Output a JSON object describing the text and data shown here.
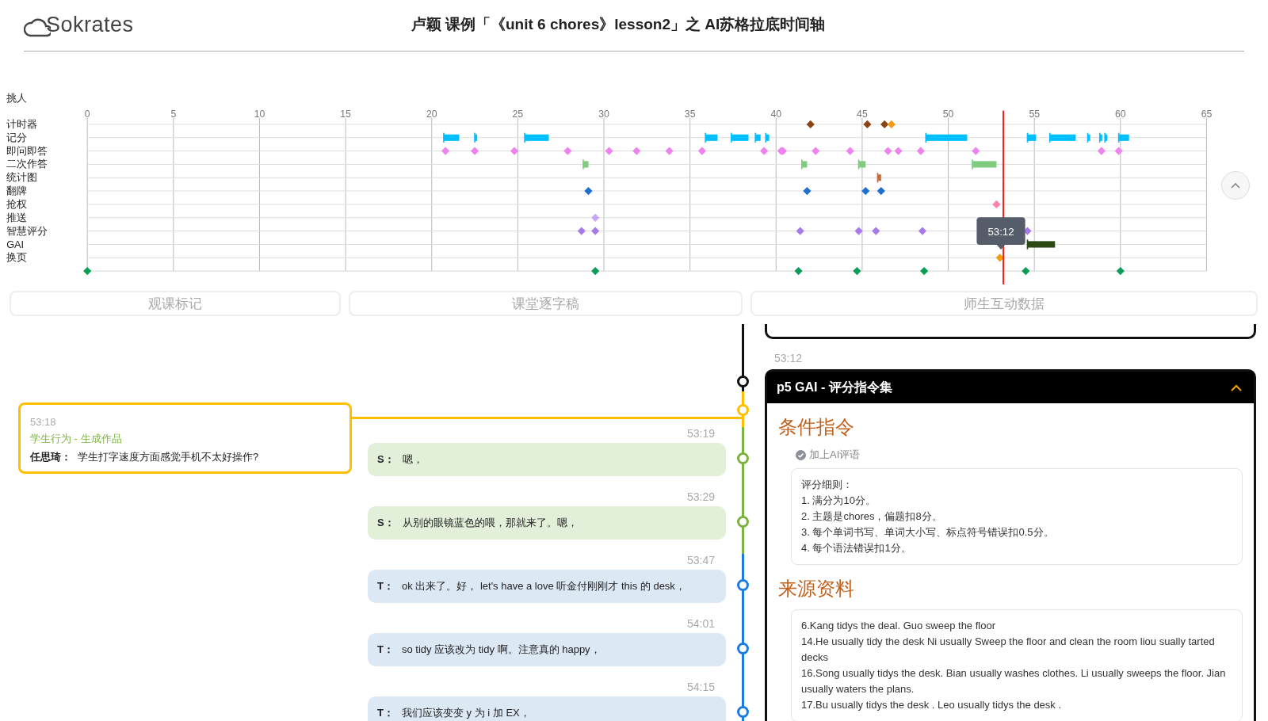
{
  "header": {
    "logo": "Sokrates",
    "title": "卢颖 课例「《unit 6 chores》lesson2」之 AI苏格拉底时间轴"
  },
  "timeline": {
    "axis_labels": [
      "0",
      "5",
      "10",
      "15",
      "20",
      "25",
      "30",
      "35",
      "40",
      "45",
      "50",
      "55",
      "60",
      "65"
    ],
    "row_labels": [
      "挑人",
      "计时器",
      "记分",
      "即问即答",
      "二次作答",
      "统计图",
      "翻牌",
      "抢权",
      "推送",
      "智慧评分",
      "GAI",
      "换页"
    ],
    "tooltip": "53:12"
  },
  "tabs": [
    {
      "label": "观课标记",
      "selected": false
    },
    {
      "label": "课堂逐字稿",
      "selected": false
    },
    {
      "label": "师生互动数据",
      "selected": false
    }
  ],
  "note": {
    "time": "53:18",
    "category": "学生行为 - 生成作品",
    "author": "任思琦：",
    "text": "学生打字速度方面感觉手机不太好操作?"
  },
  "transcript": [
    {
      "time": "53:19",
      "kind": "student",
      "speaker": "S：",
      "text": "嗯，"
    },
    {
      "time": "53:29",
      "kind": "student",
      "speaker": "S：",
      "text": "从别的眼镜蓝色的喂，那就来了。嗯，"
    },
    {
      "time": "53:47",
      "kind": "teacher",
      "speaker": "T：",
      "text": "ok 出来了。好， let's have a love 听金付刚刚才 this 的 desk，"
    },
    {
      "time": "54:01",
      "kind": "teacher",
      "speaker": "T：",
      "text": "so tidy 应该改为 tidy 啊。注意真的 happy，"
    },
    {
      "time": "54:15",
      "kind": "teacher",
      "speaker": "T：",
      "text": "我们应该变变 y 为 i 加 EX，"
    }
  ],
  "gai_card": {
    "time": "53:12",
    "title": "p5 GAI - 评分指令集",
    "expanded": true,
    "condition_heading": "条件指令",
    "option": {
      "label": "加上AI评语",
      "checked": true
    },
    "rules": [
      "评分细则：",
      "1. 满分为10分。",
      "2. 主题是chores，偏题扣8分。",
      "3. 每个单词书写、单词大小写、标点符号错误扣0.5分。",
      "4. 每个语法错误扣1分。"
    ],
    "source_heading": "来源资料",
    "sources": [
      "6.Kang tidys the deal. Guo sweep the floor",
      "14.He usually tidy the desk Ni usually Sweep the floor and clean the room liou sually tarted decks",
      "16.Song usually tidys the desk. Bian usually washes clothes. Li usually sweeps the floor. Jian usually waters the plans.",
      "17.Bu usually tidys the desk . Leo usually tidys the desk ."
    ]
  }
}
